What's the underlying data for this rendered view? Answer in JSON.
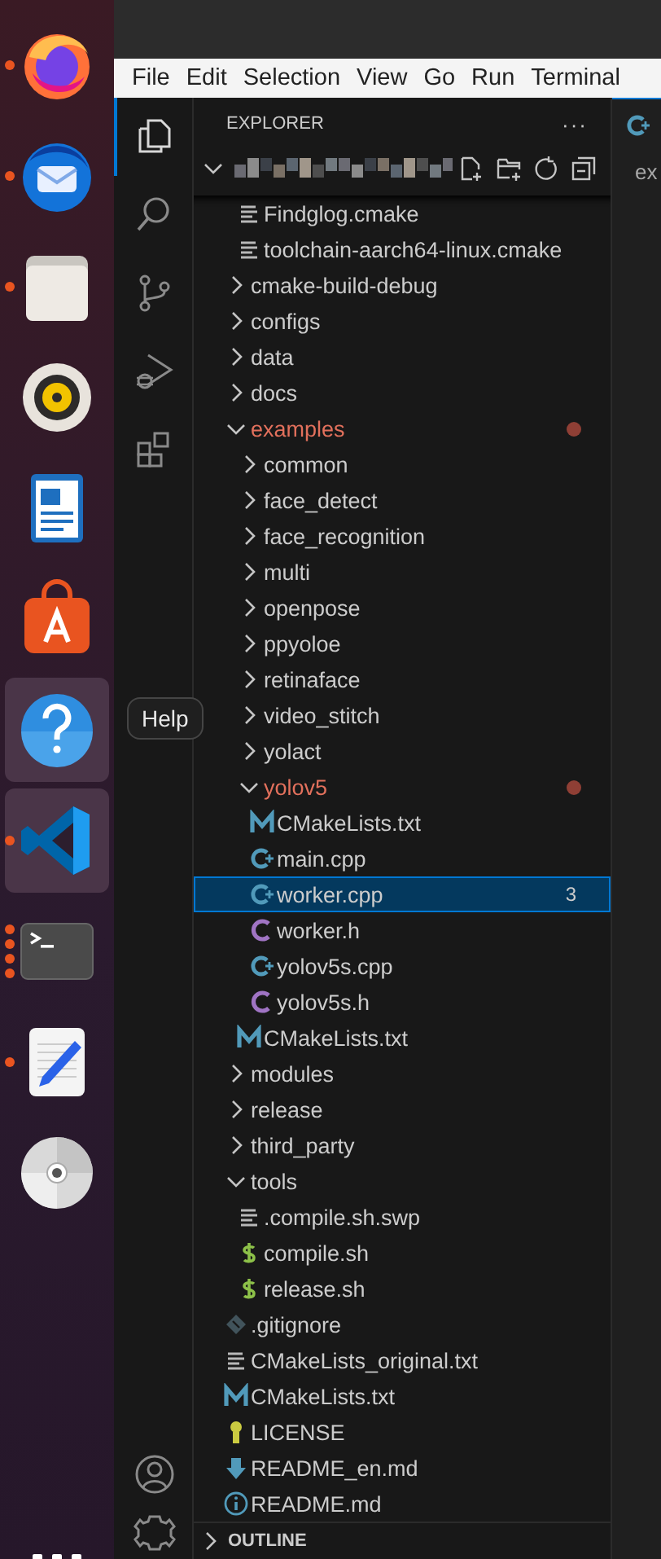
{
  "dock": {
    "items": [
      {
        "kind": "browser",
        "running": true,
        "highlighted": false
      },
      {
        "kind": "mail",
        "running": true,
        "highlighted": false
      },
      {
        "kind": "files",
        "running": true,
        "highlighted": false
      },
      {
        "kind": "music",
        "running": false,
        "highlighted": false
      },
      {
        "kind": "writer",
        "running": false,
        "highlighted": false
      },
      {
        "kind": "store",
        "running": false,
        "highlighted": false
      },
      {
        "kind": "help",
        "running": false,
        "highlighted": true
      },
      {
        "kind": "code",
        "running": true,
        "highlighted": true
      },
      {
        "kind": "terminal",
        "running": true,
        "multiple_windows": true,
        "highlighted": false
      },
      {
        "kind": "text-editor",
        "running": true,
        "highlighted": false
      },
      {
        "kind": "disc",
        "running": false,
        "highlighted": false
      }
    ],
    "tooltip": "Help"
  },
  "menu_bar": [
    "File",
    "Edit",
    "Selection",
    "View",
    "Go",
    "Run",
    "Terminal"
  ],
  "activity_bar": {
    "top": [
      {
        "kind": "explorer",
        "selected": true
      },
      {
        "kind": "search",
        "selected": false
      },
      {
        "kind": "source-control",
        "selected": false
      },
      {
        "kind": "run-debug",
        "selected": false
      },
      {
        "kind": "extensions",
        "selected": false
      }
    ],
    "bottom": [
      {
        "kind": "accounts"
      },
      {
        "kind": "manage"
      }
    ]
  },
  "explorer": {
    "title": "EXPLORER",
    "more": "···",
    "tree": [
      {
        "kind": "continued",
        "children": [
          {
            "name": "Findglog.cmake",
            "kind": "lines"
          },
          {
            "name": "toolchain-aarch64-linux.cmake",
            "kind": "lines"
          }
        ]
      },
      {
        "name": "cmake-build-debug",
        "expanded": false
      },
      {
        "name": "configs",
        "expanded": false
      },
      {
        "name": "data",
        "expanded": false
      },
      {
        "name": "docs",
        "expanded": false
      },
      {
        "name": "examples",
        "expanded": true,
        "modified": true,
        "children": [
          {
            "name": "common",
            "expanded": false
          },
          {
            "name": "face_detect",
            "expanded": false
          },
          {
            "name": "face_recognition",
            "expanded": false
          },
          {
            "name": "multi",
            "expanded": false
          },
          {
            "name": "openpose",
            "expanded": false
          },
          {
            "name": "ppyoloe",
            "expanded": false
          },
          {
            "name": "retinaface",
            "expanded": false
          },
          {
            "name": "video_stitch",
            "expanded": false
          },
          {
            "name": "yolact",
            "expanded": false
          },
          {
            "name": "yolov5",
            "expanded": true,
            "modified": true,
            "children": [
              {
                "name": "CMakeLists.txt",
                "kind": "cmake",
                "selected": false
              },
              {
                "name": "main.cpp",
                "kind": "cpp",
                "selected": false
              },
              {
                "name": "worker.cpp",
                "kind": "cpp",
                "selected": true,
                "badge": "3"
              },
              {
                "name": "worker.h",
                "kind": "h",
                "selected": false
              },
              {
                "name": "yolov5s.cpp",
                "kind": "cpp",
                "selected": false
              },
              {
                "name": "yolov5s.h",
                "kind": "h",
                "selected": false
              }
            ]
          },
          {
            "name": "CMakeLists.txt",
            "kind": "cmake"
          }
        ]
      },
      {
        "name": "modules",
        "expanded": false
      },
      {
        "name": "release",
        "expanded": false
      },
      {
        "name": "third_party",
        "expanded": false
      },
      {
        "name": "tools",
        "expanded": true,
        "children": [
          {
            "name": ".compile.sh.swp",
            "kind": "lines"
          },
          {
            "name": "compile.sh",
            "kind": "shell"
          },
          {
            "name": "release.sh",
            "kind": "shell"
          }
        ]
      },
      {
        "name": ".gitignore",
        "kind": "git"
      },
      {
        "name": "CMakeLists_original.txt",
        "kind": "lines"
      },
      {
        "name": "CMakeLists.txt",
        "kind": "cmake"
      },
      {
        "name": "LICENSE",
        "kind": "license"
      },
      {
        "name": "README_en.md",
        "kind": "download"
      },
      {
        "name": "README.md",
        "kind": "info"
      }
    ],
    "outline": "OUTLINE"
  },
  "editor": {
    "tab": {
      "kind": "cpp",
      "selected": true
    },
    "breadcrumb": "ex"
  }
}
